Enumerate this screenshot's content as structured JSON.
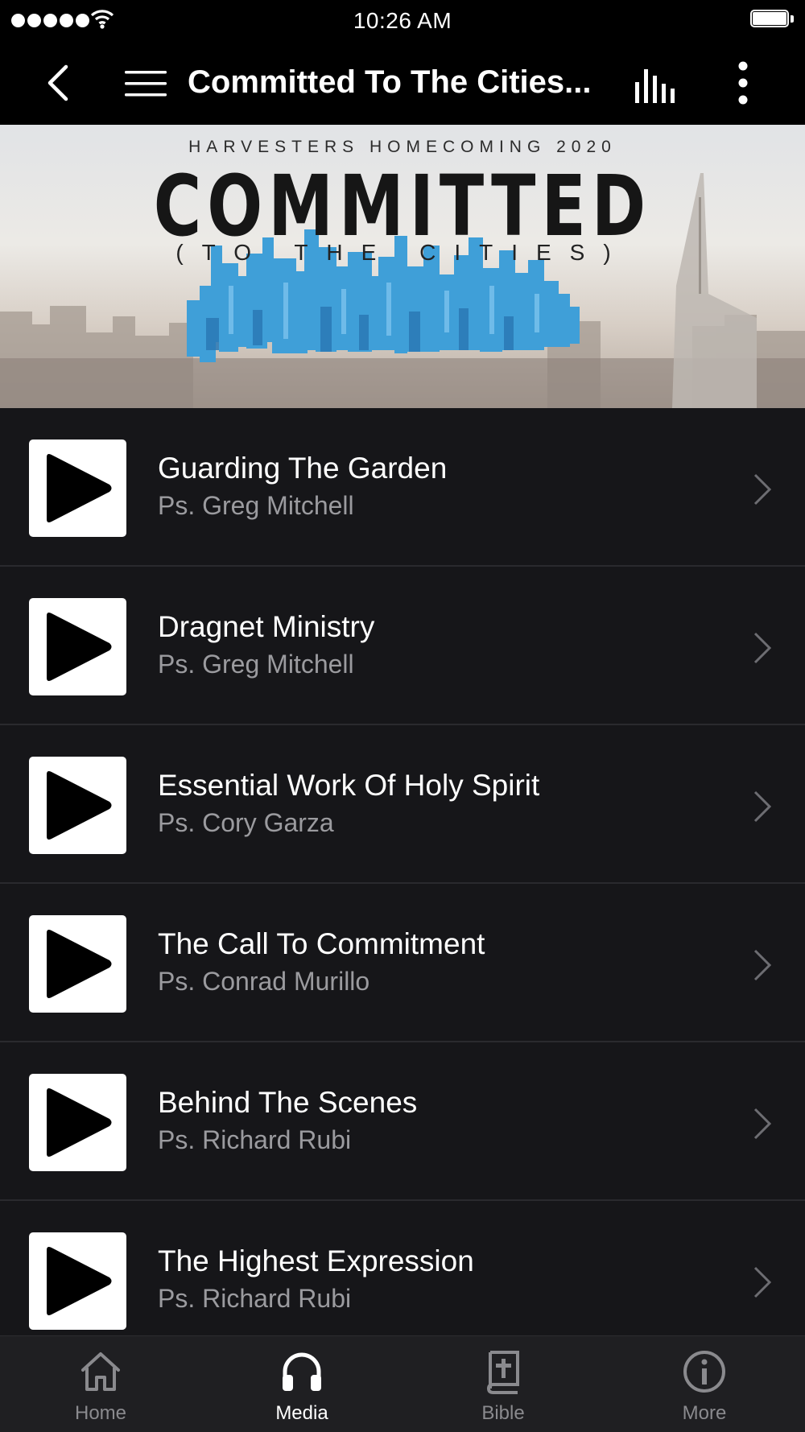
{
  "status_bar": {
    "time": "10:26 AM"
  },
  "nav": {
    "title": "Committed To The Cities...",
    "back_icon": "chevron-left-icon",
    "menu_icon": "hamburger-icon",
    "audio_icon": "audio-bars-icon",
    "more_icon": "vertical-ellipsis-icon"
  },
  "banner": {
    "kicker": "HARVESTERS HOMECOMING 2020",
    "title": "COMMITTED",
    "subtitle": "(TO THE CITIES)"
  },
  "items": [
    {
      "title": "Guarding The Garden",
      "speaker": "Ps. Greg Mitchell"
    },
    {
      "title": "Dragnet Ministry",
      "speaker": "Ps. Greg Mitchell"
    },
    {
      "title": "Essential Work Of Holy Spirit",
      "speaker": "Ps. Cory Garza"
    },
    {
      "title": "The Call To Commitment",
      "speaker": "Ps. Conrad Murillo"
    },
    {
      "title": "Behind The Scenes",
      "speaker": "Ps. Richard Rubi"
    },
    {
      "title": "The Highest Expression",
      "speaker": "Ps. Richard Rubi"
    }
  ],
  "tabs": [
    {
      "label": "Home",
      "icon": "home-icon",
      "active": false
    },
    {
      "label": "Media",
      "icon": "headphones-icon",
      "active": true
    },
    {
      "label": "Bible",
      "icon": "bible-icon",
      "active": false
    },
    {
      "label": "More",
      "icon": "info-icon",
      "active": false
    }
  ],
  "colors": {
    "background": "#000000",
    "list_background": "#161619",
    "tabbar_background": "#1f1f22",
    "skyline_blue": "#3f9fd8",
    "secondary_text": "#9b9b9f",
    "inactive_tab": "#8a8a8e"
  }
}
